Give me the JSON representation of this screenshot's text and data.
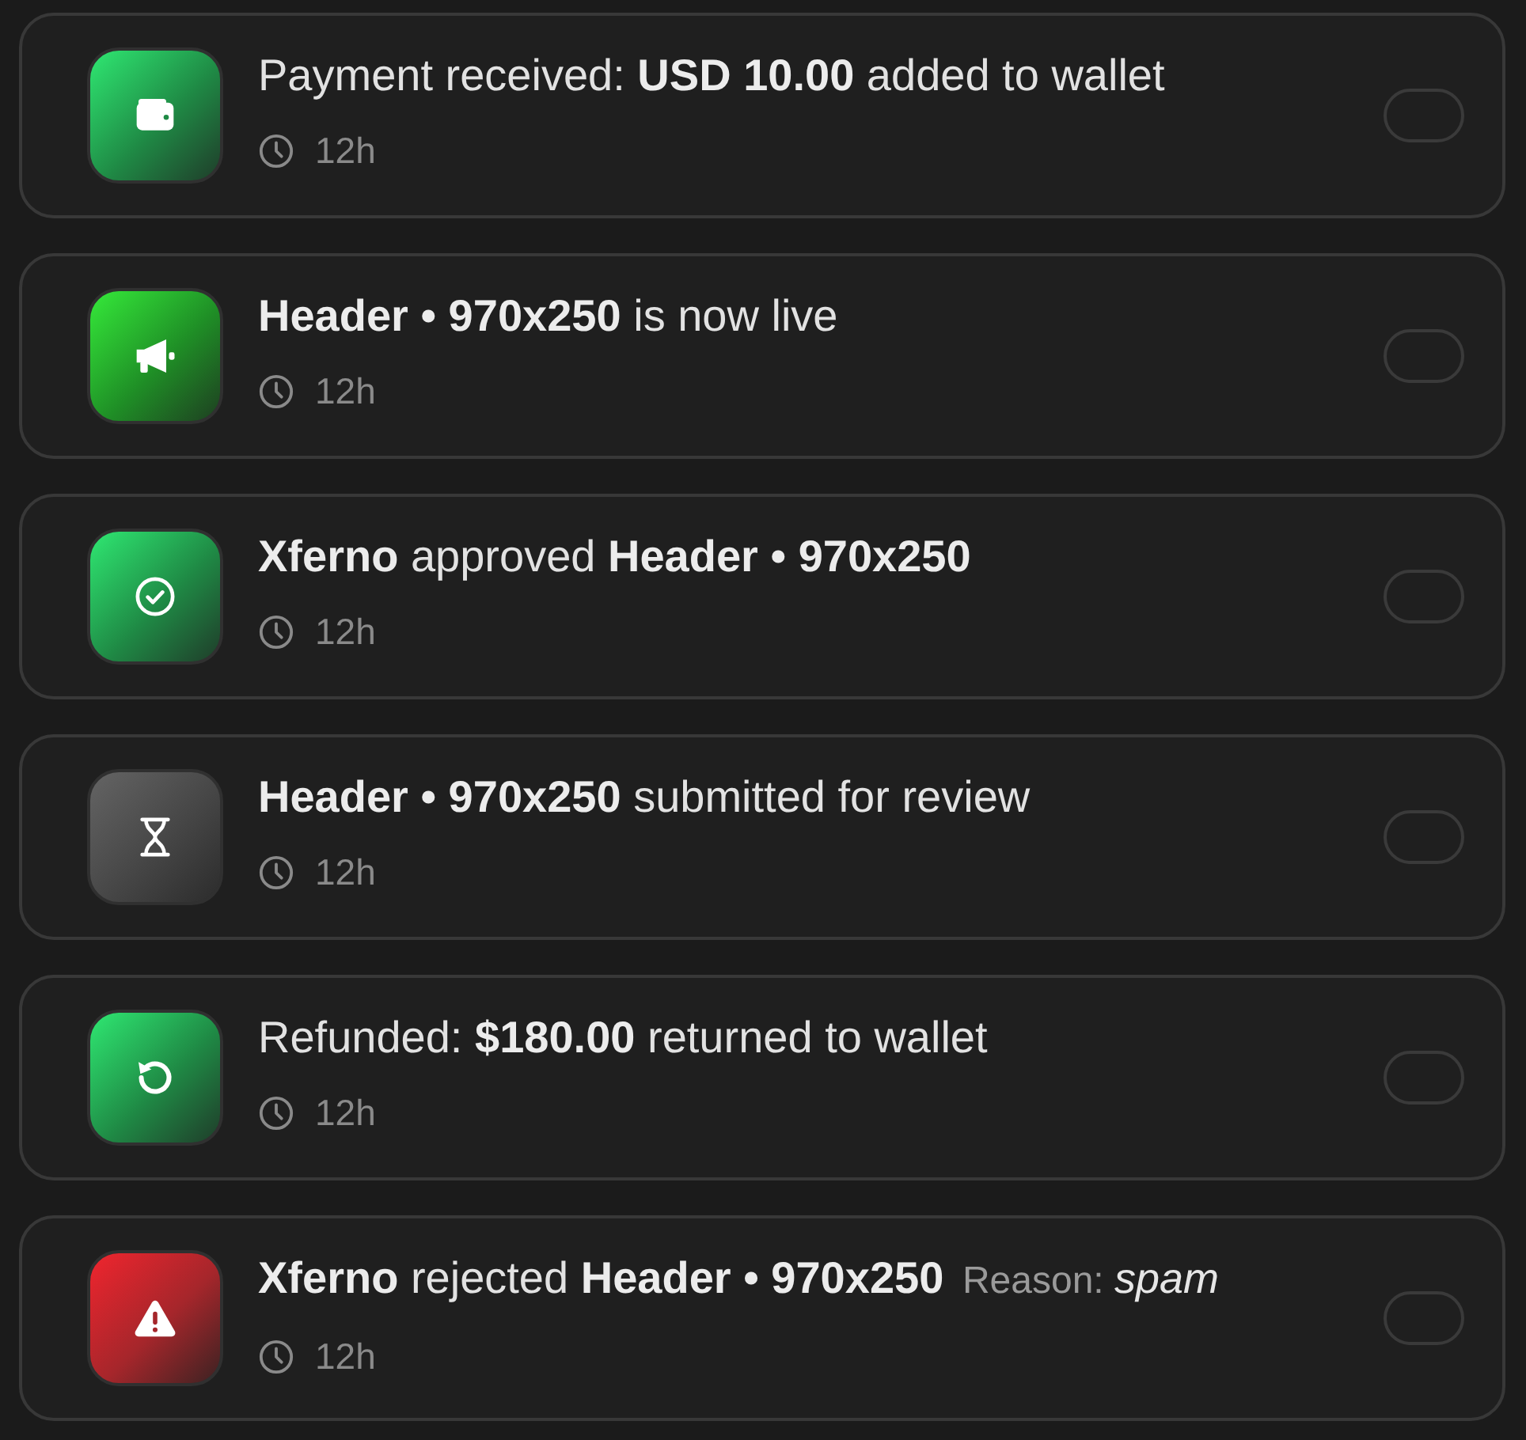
{
  "notifications": [
    {
      "kind": "payment",
      "text": "Payment received: **USD 10.00** added to wallet",
      "time": "12h"
    },
    {
      "kind": "live",
      "text": "**Header • 970x250** is now live",
      "time": "12h"
    },
    {
      "kind": "approved",
      "text": "**Xferno** approved **Header • 970x250**",
      "time": "12h"
    },
    {
      "kind": "review",
      "text": "**Header • 970x250** submitted for review",
      "time": "12h"
    },
    {
      "kind": "refund",
      "text": "Refunded: **$180.00** returned to wallet",
      "time": "12h"
    },
    {
      "kind": "rejected",
      "text": "**Xferno** rejected **Header • 970x250**",
      "reason": {
        "label": "Reason:",
        "value": "spam"
      },
      "time": "12h"
    }
  ]
}
